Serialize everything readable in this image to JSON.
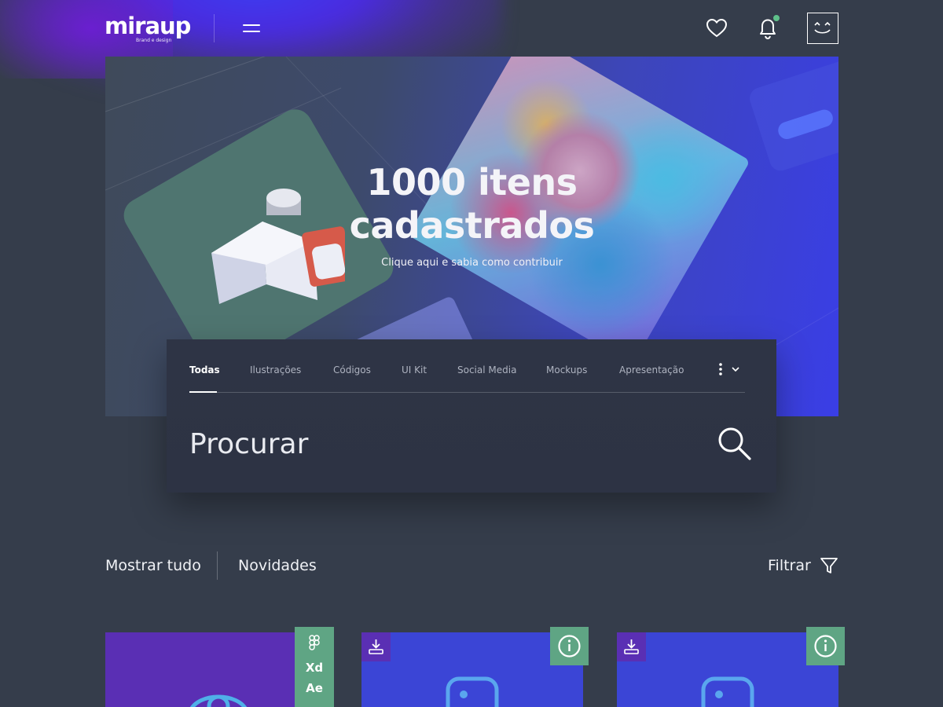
{
  "header": {
    "logo_text": "miraup",
    "logo_sub": "Brand e design",
    "icons": [
      "menu-icon",
      "heart-icon",
      "bell-icon",
      "avatar-smile-icon"
    ],
    "notification_dot_color": "#5ec08a"
  },
  "hero": {
    "title_line1": "1000 itens",
    "title_line2": "cadastrados",
    "subtitle": "Clique aqui e sabia como contribuir"
  },
  "search": {
    "categories": [
      "Todas",
      "Ilustrações",
      "Códigos",
      "UI Kit",
      "Social Media",
      "Mockups",
      "Apresentação"
    ],
    "active_category": "Todas",
    "placeholder": "Procurar"
  },
  "listing": {
    "show_all_label": "Mostrar tudo",
    "news_label": "Novidades",
    "filter_label": "Filtrar"
  },
  "cards": [
    {
      "tools": [
        "Xd",
        "Ae"
      ],
      "icon": "eye-icon",
      "color": "#5a2fb4"
    },
    {
      "icon": "image-icon",
      "color": "#3b45d6"
    },
    {
      "icon": "image-icon",
      "color": "#3b45d6"
    }
  ],
  "colors": {
    "accent_green": "#5fa584",
    "purple": "#5a2fb4",
    "blue": "#3b45d6",
    "background": "#353d4b"
  }
}
